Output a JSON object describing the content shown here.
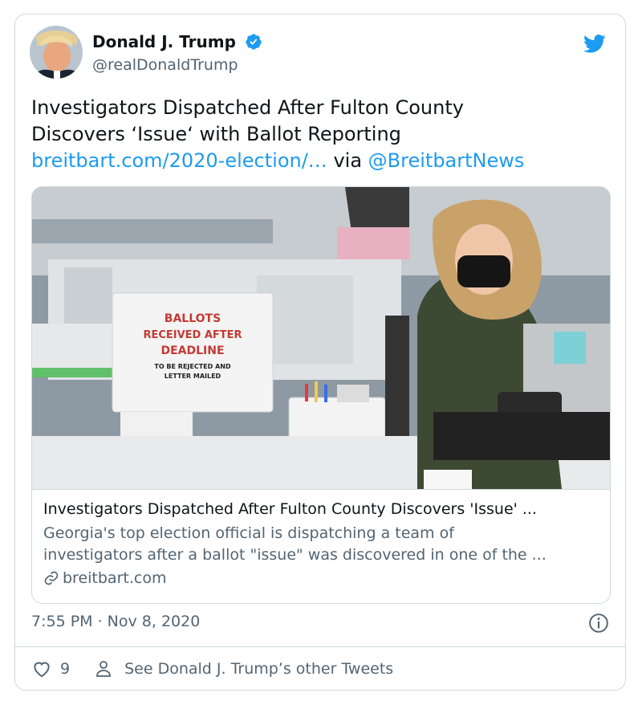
{
  "author": {
    "name": "Donald J. Trump",
    "handle": "@realDonaldTrump",
    "verified": true
  },
  "tweet": {
    "line1": "Investigators Dispatched After Fulton County",
    "line2": "Discovers ‘Issue‘ with Ballot Reporting",
    "link_text": "breitbart.com/2020-election/…",
    "via": "via",
    "mention": "@BreitbartNews"
  },
  "card": {
    "image_signs": {
      "line1": "BALLOTS",
      "line2": "RECEIVED AFTER",
      "line3": "DEADLINE",
      "line4": "TO BE REJECTED AND",
      "line5": "LETTER MAILED"
    },
    "title": "Investigators Dispatched After Fulton County Discovers 'Issue' ...",
    "desc_line1": "Georgia's top election official is dispatching a team of",
    "desc_line2": "investigators after a ballot \"issue\" was discovered in one of the ...",
    "domain": "breitbart.com"
  },
  "meta": {
    "timestamp": "7:55 PM · Nov 8, 2020"
  },
  "actions": {
    "like_count": "9",
    "profile_link": "See Donald J. Trump’s other Tweets"
  },
  "colors": {
    "accent": "#1d9bf0",
    "secondary_text": "#536471",
    "border": "#cfd9de"
  },
  "icons": [
    "verified-badge-icon",
    "twitter-bird-icon",
    "link-icon",
    "info-icon",
    "heart-icon",
    "person-icon"
  ]
}
